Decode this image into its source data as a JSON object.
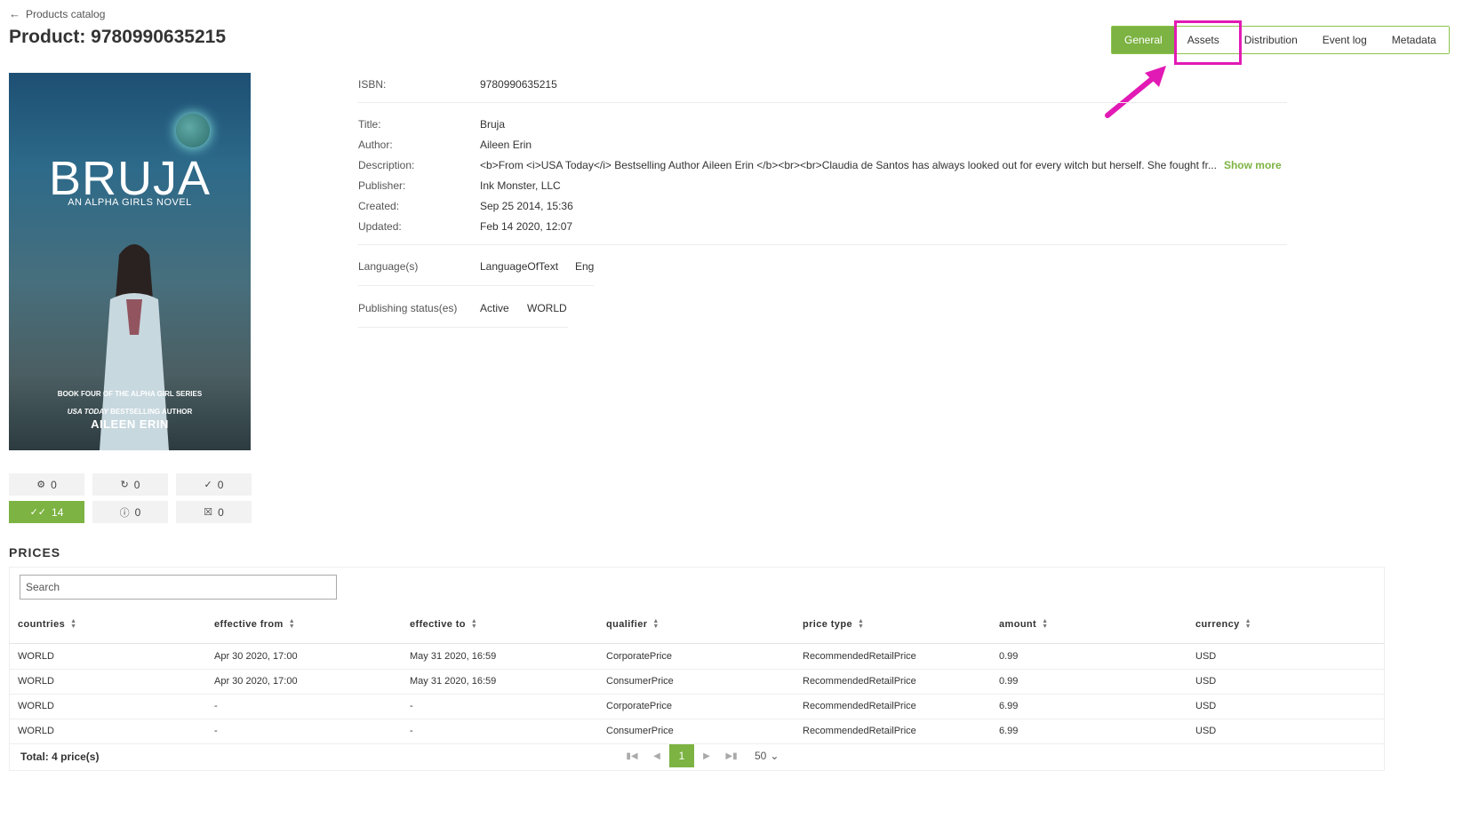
{
  "header": {
    "back_label": "Products catalog",
    "title": "Product: 9780990635215"
  },
  "tabs": [
    {
      "label": "General",
      "active": true
    },
    {
      "label": "Assets",
      "active": false
    },
    {
      "label": "Distribution",
      "active": false
    },
    {
      "label": "Event log",
      "active": false
    },
    {
      "label": "Metadata",
      "active": false
    }
  ],
  "colors": {
    "accent": "#7cb342",
    "highlight": "#e21ab5"
  },
  "cover": {
    "title": "BRUJA",
    "subtitle": "AN ALPHA GIRLS NOVEL",
    "series": "BOOK FOUR OF THE ALPHA GIRL SERIES",
    "tagline_italic": "USA TODAY",
    "tagline_rest": " BESTSELLING AUTHOR",
    "author": "AILEEN ERIN"
  },
  "counters": [
    {
      "icon": "puzzle-icon",
      "value": "0"
    },
    {
      "icon": "refresh-icon",
      "value": "0"
    },
    {
      "icon": "check-circle-icon",
      "value": "0"
    },
    {
      "icon": "double-check-icon",
      "value": "14"
    },
    {
      "icon": "info-icon",
      "value": "0"
    },
    {
      "icon": "trash-icon",
      "value": "0"
    }
  ],
  "details": {
    "isbn_label": "ISBN:",
    "isbn": "9780990635215",
    "title_label": "Title:",
    "title": "Bruja",
    "author_label": "Author:",
    "author": "Aileen Erin",
    "description_label": "Description:",
    "description": "<b>From <i>USA Today</i> Bestselling Author Aileen Erin </b><br><br>Claudia de Santos has always looked out for every witch but herself. She fought fr...",
    "show_more": "Show more",
    "publisher_label": "Publisher:",
    "publisher": "Ink Monster, LLC",
    "created_label": "Created:",
    "created": "Sep 25 2014, 15:36",
    "updated_label": "Updated:",
    "updated": "Feb 14 2020, 12:07",
    "languages_label": "Language(s)",
    "language_type": "LanguageOfText",
    "language_code": "Eng",
    "publishing_label": "Publishing status(es)",
    "publishing_status": "Active",
    "publishing_region": "WORLD"
  },
  "prices": {
    "heading": "PRICES",
    "search_placeholder": "Search",
    "columns": [
      "countries",
      "effective from",
      "effective to",
      "qualifier",
      "price type",
      "amount",
      "currency"
    ],
    "rows": [
      [
        "WORLD",
        "Apr 30 2020, 17:00",
        "May 31 2020, 16:59",
        "CorporatePrice",
        "RecommendedRetailPrice",
        "0.99",
        "USD"
      ],
      [
        "WORLD",
        "Apr 30 2020, 17:00",
        "May 31 2020, 16:59",
        "ConsumerPrice",
        "RecommendedRetailPrice",
        "0.99",
        "USD"
      ],
      [
        "WORLD",
        "-",
        "-",
        "CorporatePrice",
        "RecommendedRetailPrice",
        "6.99",
        "USD"
      ],
      [
        "WORLD",
        "-",
        "-",
        "ConsumerPrice",
        "RecommendedRetailPrice",
        "6.99",
        "USD"
      ]
    ],
    "total": "Total: 4 price(s)",
    "current_page": "1",
    "page_size": "50"
  }
}
